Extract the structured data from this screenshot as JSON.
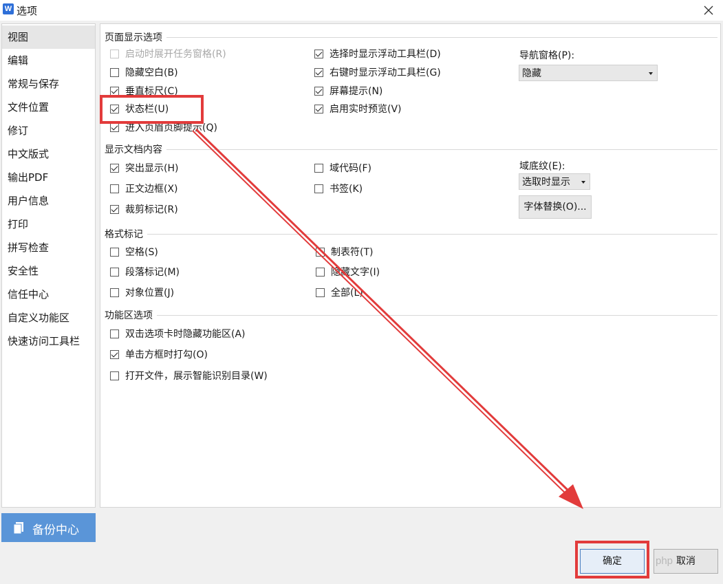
{
  "window": {
    "title": "选项"
  },
  "sidebar": {
    "items": [
      {
        "label": "视图"
      },
      {
        "label": "编辑"
      },
      {
        "label": "常规与保存"
      },
      {
        "label": "文件位置"
      },
      {
        "label": "修订"
      },
      {
        "label": "中文版式"
      },
      {
        "label": "输出PDF"
      },
      {
        "label": "用户信息"
      },
      {
        "label": "打印"
      },
      {
        "label": "拼写检查"
      },
      {
        "label": "安全性"
      },
      {
        "label": "信任中心"
      },
      {
        "label": "自定义功能区"
      },
      {
        "label": "快速访问工具栏"
      }
    ]
  },
  "backup": {
    "label": "备份中心"
  },
  "page_display": {
    "title": "页面显示选项",
    "options": [
      {
        "label": "启动时展开任务窗格(R)",
        "checked": false,
        "disabled": true
      },
      {
        "label": "隐藏空白(B)",
        "checked": false
      },
      {
        "label": "垂直标尺(C)",
        "checked": true
      },
      {
        "label": "状态栏(U)",
        "checked": true
      },
      {
        "label": "进入页眉页脚提示(Q)",
        "checked": true
      },
      {
        "label": "选择时显示浮动工具栏(D)",
        "checked": true
      },
      {
        "label": "右键时显示浮动工具栏(G)",
        "checked": true
      },
      {
        "label": "屏幕提示(N)",
        "checked": true
      },
      {
        "label": "启用实时预览(V)",
        "checked": true
      }
    ],
    "nav_pane_label": "导航窗格(P):",
    "nav_pane_value": "隐藏"
  },
  "doc_content": {
    "title": "显示文档内容",
    "options": [
      {
        "label": "突出显示(H)",
        "checked": true
      },
      {
        "label": "正文边框(X)",
        "checked": false
      },
      {
        "label": "裁剪标记(R)",
        "checked": true
      },
      {
        "label": "域代码(F)",
        "checked": false
      },
      {
        "label": "书签(K)",
        "checked": false
      }
    ],
    "field_shading_label": "域底纹(E):",
    "field_shading_value": "选取时显示",
    "font_substitution_label": "字体替换(O)..."
  },
  "format_marks": {
    "title": "格式标记",
    "options": [
      {
        "label": "空格(S)",
        "checked": false
      },
      {
        "label": "段落标记(M)",
        "checked": false
      },
      {
        "label": "对象位置(J)",
        "checked": false
      },
      {
        "label": "制表符(T)",
        "checked": false
      },
      {
        "label": "隐藏文字(I)",
        "checked": false
      },
      {
        "label": "全部(L)",
        "checked": false
      }
    ]
  },
  "ribbon": {
    "title": "功能区选项",
    "options": [
      {
        "label": "双击选项卡时隐藏功能区(A)",
        "checked": false
      },
      {
        "label": "单击方框时打勾(O)",
        "checked": true
      },
      {
        "label": "打开文件，展示智能识别目录(W)",
        "checked": false
      }
    ]
  },
  "footer": {
    "ok_label": "确定",
    "cancel_label": "取消"
  },
  "watermark": {
    "text": "php"
  },
  "colors": {
    "highlight": "#e23b3b",
    "accent": "#5a95d8"
  }
}
